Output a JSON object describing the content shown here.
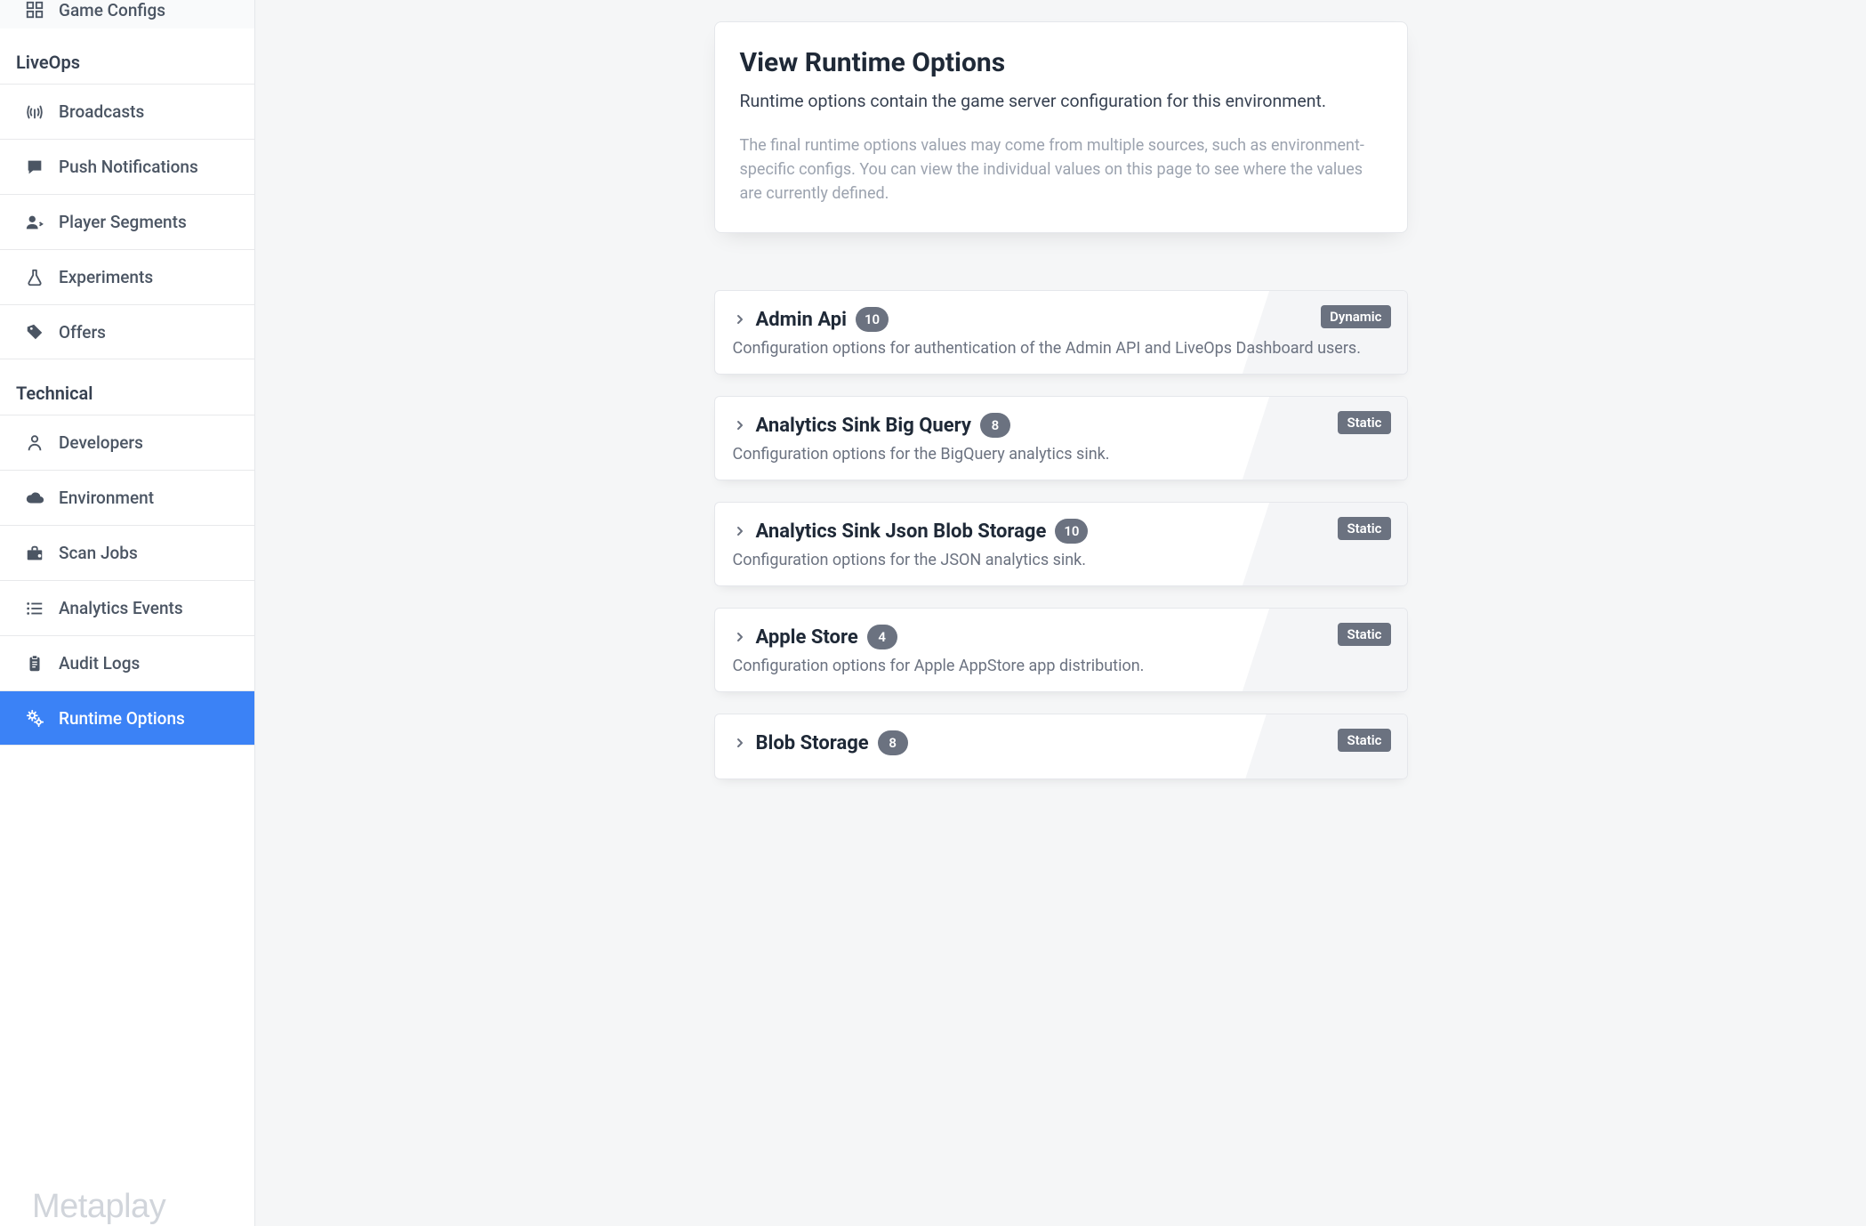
{
  "sidebar": {
    "top_item": {
      "label": "Game Configs",
      "icon": "grid-icon"
    },
    "groups": [
      {
        "header": "LiveOps",
        "items": [
          {
            "label": "Broadcasts",
            "icon": "antenna-icon",
            "active": false
          },
          {
            "label": "Push Notifications",
            "icon": "comment-icon",
            "active": false
          },
          {
            "label": "Player Segments",
            "icon": "users-icon",
            "active": false
          },
          {
            "label": "Experiments",
            "icon": "flask-icon",
            "active": false
          },
          {
            "label": "Offers",
            "icon": "tags-icon",
            "active": false
          }
        ]
      },
      {
        "header": "Technical",
        "items": [
          {
            "label": "Developers",
            "icon": "person-icon",
            "active": false
          },
          {
            "label": "Environment",
            "icon": "cloud-icon",
            "active": false
          },
          {
            "label": "Scan Jobs",
            "icon": "briefcase-icon",
            "active": false
          },
          {
            "label": "Analytics Events",
            "icon": "list-icon",
            "active": false
          },
          {
            "label": "Audit Logs",
            "icon": "clipboard-icon",
            "active": false
          },
          {
            "label": "Runtime Options",
            "icon": "gears-icon",
            "active": true
          }
        ]
      }
    ],
    "brand": "Metaplay"
  },
  "main": {
    "intro": {
      "title": "View Runtime Options",
      "lead": "Runtime options contain the game server configuration for this environment.",
      "detail": "The final runtime options values may come from multiple sources, such as environment-specific configs. You can view the individual values on this page to see where the values are currently defined."
    },
    "options": [
      {
        "title": "Admin Api",
        "count": "10",
        "tag": "Dynamic",
        "desc": "Configuration options for authentication of the Admin API and LiveOps Dashboard users."
      },
      {
        "title": "Analytics Sink Big Query",
        "count": "8",
        "tag": "Static",
        "desc": "Configuration options for the BigQuery analytics sink."
      },
      {
        "title": "Analytics Sink Json Blob Storage",
        "count": "10",
        "tag": "Static",
        "desc": "Configuration options for the JSON analytics sink."
      },
      {
        "title": "Apple Store",
        "count": "4",
        "tag": "Static",
        "desc": "Configuration options for Apple AppStore app distribution."
      },
      {
        "title": "Blob Storage",
        "count": "8",
        "tag": "Static",
        "desc": ""
      }
    ]
  }
}
